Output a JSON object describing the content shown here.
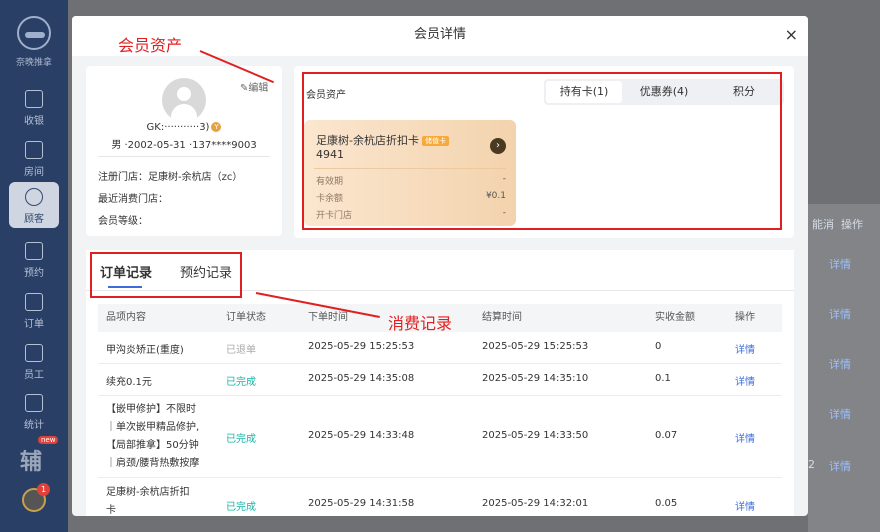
{
  "sidebar": {
    "logo_text": "奈晚推拿",
    "items": [
      {
        "label": "收银"
      },
      {
        "label": "房间"
      },
      {
        "label": "顾客"
      },
      {
        "label": "预约"
      },
      {
        "label": "订单"
      },
      {
        "label": "员工"
      },
      {
        "label": "统计"
      }
    ],
    "new_badge": "new",
    "fu": "辅",
    "avatar_count": "1"
  },
  "background": {
    "op_header": "操作",
    "op_prefix": "能消",
    "links": [
      "详情",
      "详情",
      "详情",
      "详情",
      "详情"
    ],
    "num": "2"
  },
  "modal": {
    "title": "会员详情",
    "close": "×"
  },
  "profile": {
    "edit_label": "编辑",
    "name": "GK:···········3)",
    "vip": "Y",
    "info": "男 ·2002-05-31 ·137****9003",
    "store_label": "注册门店：足康树-余杭店（zc）",
    "recent_label": "最近消费门店：",
    "level_label": "会员等级："
  },
  "assets": {
    "title": "会员资产",
    "tabs": [
      "持有卡(1)",
      "优惠券(4)",
      "积分"
    ],
    "card": {
      "name": "足康树-余杭店折扣卡",
      "tag": "储值卡",
      "number": "4941",
      "rows": [
        {
          "label": "有效期",
          "value": "-"
        },
        {
          "label": "卡余额",
          "value": "¥0.1"
        },
        {
          "label": "开卡门店",
          "value": "-"
        }
      ]
    }
  },
  "annotations": {
    "assets": "会员资产",
    "records": "消费记录"
  },
  "records": {
    "tabs": [
      "订单记录",
      "预约记录"
    ],
    "columns": [
      "品项内容",
      "订单状态",
      "下单时间",
      "结算时间",
      "实收金额",
      "操作"
    ],
    "rows": [
      {
        "item": [
          "甲沟炎矫正(重度)"
        ],
        "status": "已退单",
        "order_time": "2025-05-29 15:25:53",
        "settle_time": "2025-05-29 15:25:53",
        "amount": "0",
        "op": "详情"
      },
      {
        "item": [
          "续充0.1元"
        ],
        "status": "已完成",
        "order_time": "2025-05-29 14:35:08",
        "settle_time": "2025-05-29 14:35:10",
        "amount": "0.1",
        "op": "详情"
      },
      {
        "item": [
          "【嵌甲修护】不限时",
          "｜单次嵌甲精品修护,",
          "【局部推拿】50分钟",
          "｜肩颈/腰背热敷按摩"
        ],
        "status": "已完成",
        "order_time": "2025-05-29 14:33:48",
        "settle_time": "2025-05-29 14:33:50",
        "amount": "0.07",
        "op": "详情"
      },
      {
        "item": [
          "足康树-余杭店折扣",
          "卡"
        ],
        "status": "已完成",
        "order_time": "2025-05-29 14:31:58",
        "settle_time": "2025-05-29 14:32:01",
        "amount": "0.05",
        "op": "详情"
      }
    ]
  }
}
